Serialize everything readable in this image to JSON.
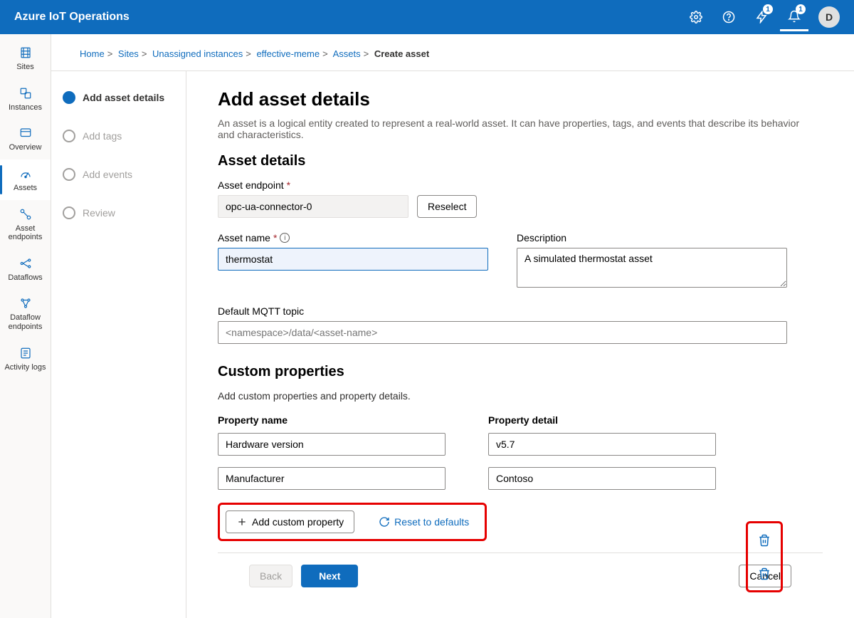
{
  "brand": "Azure IoT Operations",
  "badges": {
    "feedback": "1",
    "notifications": "1"
  },
  "avatar_initial": "D",
  "sidebar": [
    {
      "label": "Sites"
    },
    {
      "label": "Instances"
    },
    {
      "label": "Overview"
    },
    {
      "label": "Assets"
    },
    {
      "label": "Asset endpoints"
    },
    {
      "label": "Dataflows"
    },
    {
      "label": "Dataflow endpoints"
    },
    {
      "label": "Activity logs"
    }
  ],
  "breadcrumb": [
    "Home",
    "Sites",
    "Unassigned instances",
    "effective-meme",
    "Assets"
  ],
  "breadcrumb_current": "Create asset",
  "wizard": [
    {
      "label": "Add asset details"
    },
    {
      "label": "Add tags"
    },
    {
      "label": "Add events"
    },
    {
      "label": "Review"
    }
  ],
  "page": {
    "title": "Add asset details",
    "intro": "An asset is a logical entity created to represent a real-world asset. It can have properties, tags, and events that describe its behavior and characteristics.",
    "details_heading": "Asset details",
    "endpoint_label": "Asset endpoint",
    "endpoint_value": "opc-ua-connector-0",
    "reselect": "Reselect",
    "name_label": "Asset name",
    "name_value": "thermostat",
    "desc_label": "Description",
    "desc_value": "A simulated thermostat asset",
    "mqtt_label": "Default MQTT topic",
    "mqtt_placeholder": "<namespace>/data/<asset-name>",
    "custom_heading": "Custom properties",
    "custom_sub": "Add custom properties and property details.",
    "propname_header": "Property name",
    "propdetail_header": "Property detail",
    "properties": [
      {
        "name": "Hardware version",
        "detail": "v5.7"
      },
      {
        "name": "Manufacturer",
        "detail": "Contoso"
      }
    ],
    "add_custom": "Add custom property",
    "reset_defaults": "Reset to defaults"
  },
  "footer": {
    "back": "Back",
    "next": "Next",
    "cancel": "Cancel"
  }
}
